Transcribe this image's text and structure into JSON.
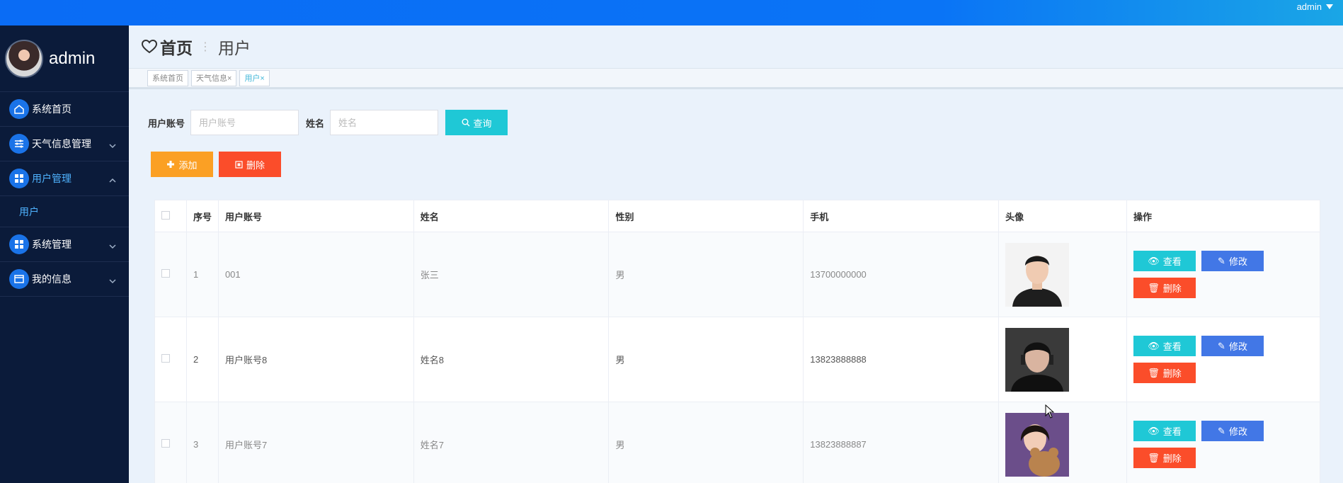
{
  "topbar": {
    "user": "admin"
  },
  "sidebar": {
    "brand": "admin",
    "items": [
      {
        "label": "系统首页",
        "icon": "home-icon"
      },
      {
        "label": "天气信息管理",
        "icon": "sliders-icon"
      },
      {
        "label": "用户管理",
        "icon": "grid-icon"
      },
      {
        "label": "系统管理",
        "icon": "grid-icon"
      },
      {
        "label": "我的信息",
        "icon": "window-icon"
      }
    ],
    "submenu": {
      "label": "用户"
    }
  },
  "header": {
    "home": "首页",
    "page": "用户"
  },
  "tags": [
    {
      "label": "系统首页"
    },
    {
      "label": "天气信息×"
    },
    {
      "label": "用户×"
    }
  ],
  "search": {
    "account_label": "用户账号",
    "account_placeholder": "用户账号",
    "name_label": "姓名",
    "name_placeholder": "姓名",
    "query_label": "查询"
  },
  "actions": {
    "add_label": "添加",
    "delete_label": "删除"
  },
  "table": {
    "columns": [
      "序号",
      "用户账号",
      "姓名",
      "性别",
      "手机",
      "头像",
      "操作"
    ],
    "rows": [
      {
        "index": "1",
        "account": "001",
        "name": "张三",
        "gender": "男",
        "phone": "13700000000"
      },
      {
        "index": "2",
        "account": "用户账号8",
        "name": "姓名8",
        "gender": "男",
        "phone": "13823888888"
      },
      {
        "index": "3",
        "account": "用户账号7",
        "name": "姓名7",
        "gender": "男",
        "phone": "13823888887"
      }
    ],
    "view_label": "查看",
    "edit_label": "修改",
    "remove_label": "删除"
  },
  "colors": {
    "accent": "#1fc8d6",
    "primary": "#4277e6",
    "danger": "#fb4d2a",
    "warning": "#fba024",
    "sidebar": "#0b1b3a"
  }
}
